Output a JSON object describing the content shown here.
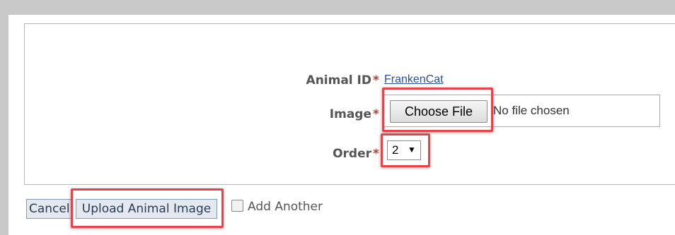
{
  "form": {
    "animal_id": {
      "label": "Animal ID",
      "required_mark": "*",
      "value": "FrankenCat"
    },
    "image": {
      "label": "Image",
      "required_mark": "*",
      "button_label": "Choose File",
      "status_text": "No file chosen"
    },
    "order": {
      "label": "Order",
      "required_mark": "*",
      "selected": "2",
      "arrow": "▼"
    }
  },
  "footer": {
    "cancel_label": "Cancel",
    "upload_label": "Upload Animal Image",
    "add_another_label": "Add Another",
    "add_another_checked": false
  },
  "colors": {
    "highlight": "#e8434a",
    "required": "#c0392b",
    "link": "#2a4f9a"
  }
}
